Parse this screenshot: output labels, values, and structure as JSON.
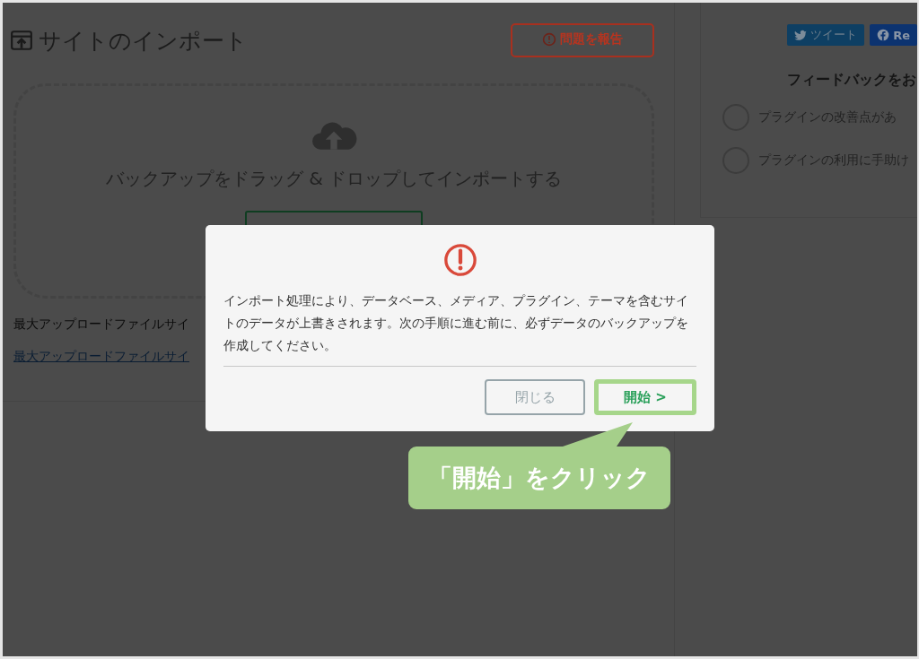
{
  "page": {
    "title": "サイトのインポート",
    "report_button": "問題を報告",
    "dropzone_text": "バックアップをドラッグ & ドロップしてインポートする",
    "max_size_text": "最大アップロードファイルサイ",
    "max_size_link": "最大アップロードファイルサイ"
  },
  "sidebar": {
    "share_buttons": [
      {
        "kind": "twitter",
        "label": "ツイート"
      },
      {
        "kind": "facebook",
        "label": "Re"
      }
    ],
    "feedback_title": "フィードバックをお",
    "options": [
      {
        "label": "プラグインの改善点があ",
        "selected": false
      },
      {
        "label": "プラグインの利用に手助け",
        "selected": false
      }
    ]
  },
  "dialog": {
    "message": "インポート処理により、データベース、メディア、プラグイン、テーマを含むサイトのデータが上書きされます。次の手順に進む前に、必ずデータのバックアップを作成してください。",
    "buttons": [
      {
        "kind": "secondary",
        "label": "閉じる",
        "highlighted": false
      },
      {
        "kind": "primary",
        "label": "開始 >",
        "highlighted": true
      }
    ]
  },
  "callout": {
    "text": "「開始」をクリック"
  }
}
